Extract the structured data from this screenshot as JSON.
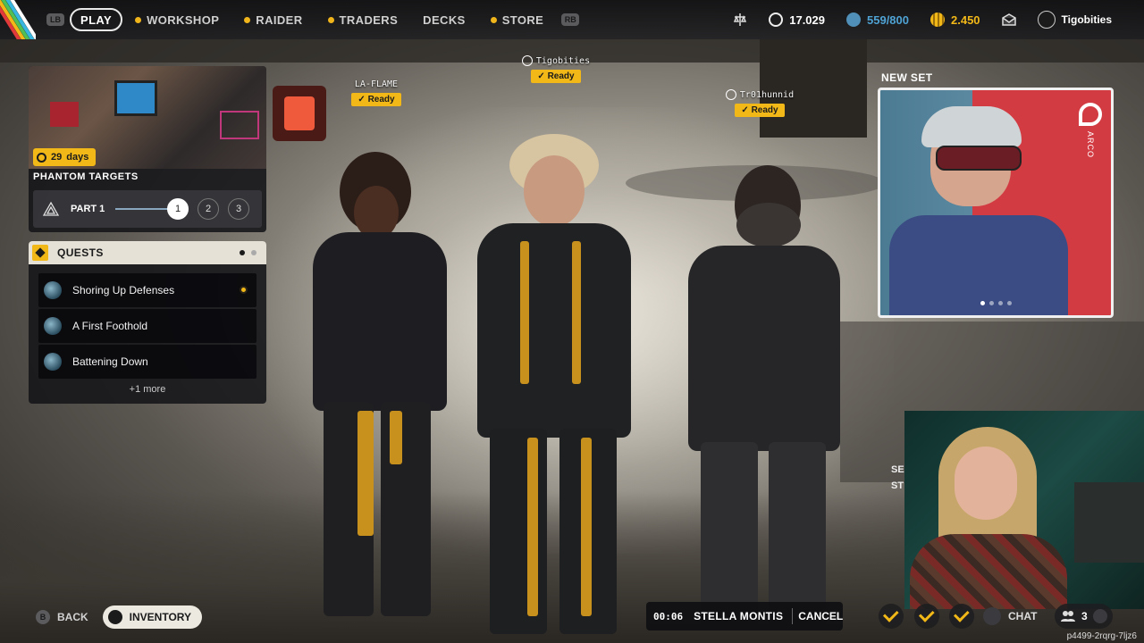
{
  "topbar": {
    "lb": "LB",
    "rb": "RB",
    "nav": [
      {
        "label": "PLAY",
        "active": true,
        "dot": false
      },
      {
        "label": "WORKSHOP",
        "active": false,
        "dot": true
      },
      {
        "label": "RAIDER",
        "active": false,
        "dot": true
      },
      {
        "label": "TRADERS",
        "active": false,
        "dot": true
      },
      {
        "label": "DECKS",
        "active": false,
        "dot": false
      },
      {
        "label": "STORE",
        "active": false,
        "dot": true
      }
    ],
    "stats": {
      "coins": "17.029",
      "capacity": "559/800",
      "credits": "2.450"
    },
    "username": "Tigobities"
  },
  "event": {
    "days": "29",
    "days_unit": "days",
    "title": "PHANTOM TARGETS",
    "part_label": "PART 1",
    "steps": [
      "1",
      "2",
      "3"
    ]
  },
  "quests": {
    "title": "QUESTS",
    "items": [
      {
        "label": "Shoring Up Defenses"
      },
      {
        "label": "A First Foothold"
      },
      {
        "label": "Battening Down"
      }
    ],
    "more": "+1 more"
  },
  "party": [
    {
      "name": "LA-FLAME",
      "status": "Ready"
    },
    {
      "name": "Tigobities",
      "status": "Ready"
    },
    {
      "name": "Tr01hunnid",
      "status": "Ready"
    }
  ],
  "newset": {
    "label": "NEW SET",
    "brand": "ARCO"
  },
  "webcam_overlay": {
    "line1": "SE",
    "line2": "ST"
  },
  "bottom": {
    "back_key": "B",
    "back": "BACK",
    "inventory": "INVENTORY",
    "timer": "00:06",
    "map": "STELLA MONTIS",
    "cancel": "CANCEL",
    "chat": "CHAT",
    "party_count": "3",
    "session_id": "p4499-2rqrg-7ljz6"
  },
  "colors": {
    "accent": "#f2b818",
    "panel": "#141418",
    "quest_header": "#e5e1d6"
  }
}
